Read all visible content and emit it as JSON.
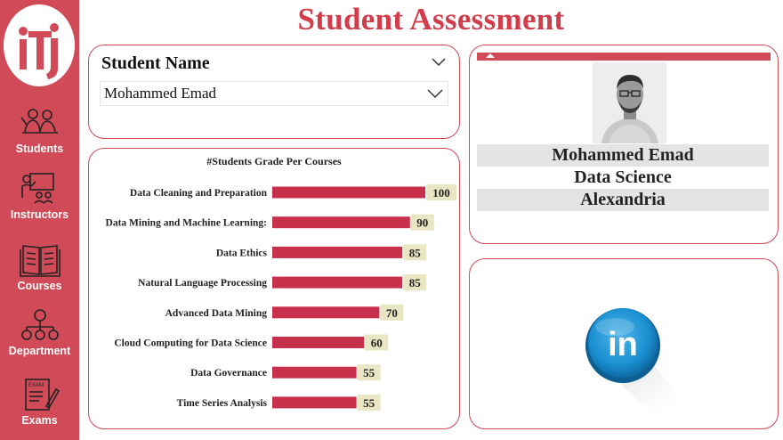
{
  "title": "Student Assessment",
  "logo": {
    "text": "iti",
    "icon": "iti-logo"
  },
  "sidebar": {
    "items": [
      {
        "label": "Students",
        "icon": "students-icon"
      },
      {
        "label": "Instructors",
        "icon": "instructor-board-icon"
      },
      {
        "label": "Courses",
        "icon": "open-book-icon"
      },
      {
        "label": "Department",
        "icon": "org-chart-icon"
      },
      {
        "label": "Exams",
        "icon": "exam-paper-icon"
      }
    ]
  },
  "slicer": {
    "title": "Student Name",
    "selected": "Mohammed Emad"
  },
  "chart_data": {
    "type": "bar",
    "orientation": "horizontal",
    "title": "#Students Grade Per Courses",
    "categories": [
      "Data Cleaning and Preparation",
      "Data Mining and Machine Learning:",
      "Data Ethics",
      "Natural Language Processing",
      "Advanced Data Mining",
      "Cloud Computing for Data Science",
      "Data Governance",
      "Time Series Analysis"
    ],
    "values": [
      100,
      90,
      85,
      85,
      70,
      60,
      55,
      55
    ],
    "xlim": [
      0,
      100
    ],
    "bar_color": "#c7304a",
    "label_bg": "#e9e6c4",
    "grid": false
  },
  "profile": {
    "name": "Mohammed Emad",
    "track": "Data Science",
    "branch": "Alexandria"
  },
  "linkedin": {
    "text": "in",
    "icon": "linkedin-icon"
  },
  "colors": {
    "accent": "#d04a58",
    "title": "#d23c4b",
    "linkedin": "#1a8fd0"
  }
}
